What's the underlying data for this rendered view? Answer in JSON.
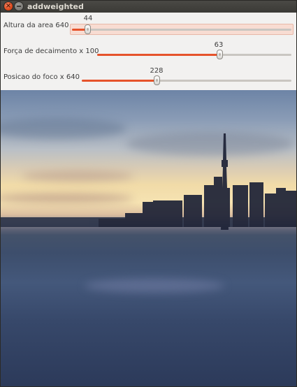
{
  "window": {
    "title": "addweighted"
  },
  "sliders": [
    {
      "label": "Altura da area 640",
      "value": "44",
      "fraction": 0.0688
    },
    {
      "label": "Força de decaimento x 100",
      "value": "63",
      "fraction": 0.63
    },
    {
      "label": "Posicao do foco x 640",
      "value": "228",
      "fraction": 0.3563
    }
  ],
  "colors": {
    "accent": "#e6532b",
    "close": "#df4a1c"
  },
  "icons": {
    "close": "close-icon",
    "minimize": "minimize-icon"
  }
}
